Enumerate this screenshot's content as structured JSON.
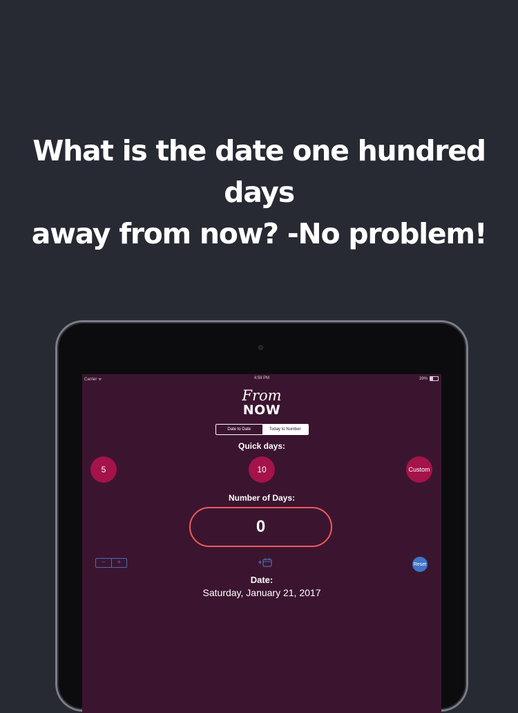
{
  "headline": {
    "line1": "What is the date one hundred days",
    "line2": "away from now? -No problem!"
  },
  "status_bar": {
    "carrier": "Carrier",
    "time": "4:59 PM",
    "battery": "39%"
  },
  "app": {
    "logo_from": "From",
    "logo_now": "NOW",
    "segments": [
      "Date to Date",
      "Today to Number"
    ],
    "selected_segment": "Today to Number",
    "quick_days_label": "Quick days:",
    "quick_days": [
      "5",
      "10",
      "Custom"
    ],
    "number_of_days_label": "Number of Days:",
    "number_of_days_value": "0",
    "stepper": {
      "minus": "−",
      "plus": "+"
    },
    "reset_label": "Reset",
    "date_label": "Date:",
    "date_value": "Saturday, January 21, 2017"
  },
  "colors": {
    "page_background": "#282a33",
    "screen_background": "#3b1530",
    "accent_button": "#a4134a",
    "field_border": "#f25a5a",
    "reset_button": "#3f74c8"
  }
}
